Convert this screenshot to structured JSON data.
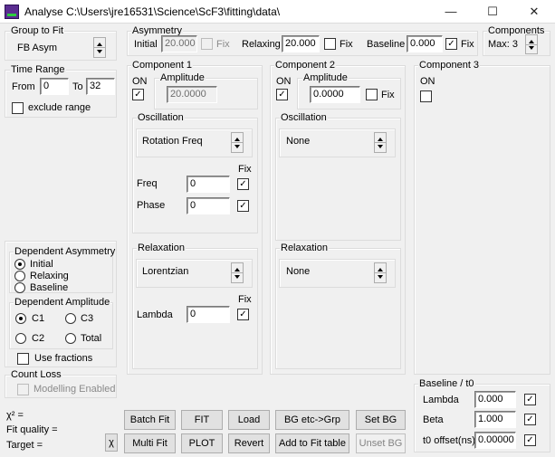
{
  "window": {
    "title": "Analyse C:\\Users\\jre16531\\Science\\ScF3\\fitting\\data\\",
    "min_glyph": "—",
    "max_glyph": "☐",
    "close_glyph": "✕"
  },
  "group_to_fit": {
    "legend": "Group to Fit",
    "value": "FB Asym"
  },
  "time_range": {
    "legend": "Time Range",
    "from_label": "From",
    "from_value": "0",
    "to_label": "To",
    "to_value": "32",
    "exclude_label": "exclude range"
  },
  "asymmetry": {
    "legend": "Asymmetry",
    "initial_label": "Initial",
    "initial_value": "20.000",
    "initial_fix": "Fix",
    "relaxing_label": "Relaxing",
    "relaxing_value": "20.000",
    "relaxing_fix": "Fix",
    "baseline_label": "Baseline",
    "baseline_value": "0.000",
    "baseline_fix": "Fix"
  },
  "components": {
    "legend": "Components",
    "max_label": "Max: 3"
  },
  "component1": {
    "legend": "Component 1",
    "on_label": "ON",
    "amplitude_legend": "Amplitude",
    "amplitude_value": "20.0000",
    "osc_legend": "Oscillation",
    "osc_value": "Rotation Freq",
    "fix_header": "Fix",
    "freq_label": "Freq",
    "freq_value": "0",
    "phase_label": "Phase",
    "phase_value": "0",
    "relax_legend": "Relaxation",
    "relax_value": "Lorentzian",
    "lambda_fix_header": "Fix",
    "lambda_label": "Lambda",
    "lambda_value": "0"
  },
  "component2": {
    "legend": "Component 2",
    "on_label": "ON",
    "amplitude_legend": "Amplitude",
    "amplitude_value": "0.0000",
    "amplitude_fix": "Fix",
    "osc_legend": "Oscillation",
    "osc_value": "None",
    "relax_legend": "Relaxation",
    "relax_value": "None"
  },
  "component3": {
    "legend": "Component 3",
    "on_label": "ON"
  },
  "dependent_asymmetry": {
    "legend": "Dependent Asymmetry",
    "options": [
      "Initial",
      "Relaxing",
      "Baseline"
    ]
  },
  "dependent_amplitude": {
    "legend": "Dependent Amplitude",
    "c1": "C1",
    "c3": "C3",
    "c2": "C2",
    "total": "Total"
  },
  "use_fractions": "Use fractions",
  "count_loss": {
    "legend": "Count Loss",
    "modelling_label": "Modelling Enabled"
  },
  "stats": {
    "chi2_label": "χ² =",
    "fit_quality_label": "Fit quality =",
    "target_label": "Target =",
    "chi_button": "χ"
  },
  "buttons": {
    "batch_fit": "Batch Fit",
    "fit": "FIT",
    "load": "Load",
    "bg_etc": "BG etc->Grp",
    "set_bg": "Set BG",
    "multi_fit": "Multi Fit",
    "plot": "PLOT",
    "revert": "Revert",
    "add_to_fit_table": "Add to Fit table",
    "unset_bg": "Unset BG"
  },
  "baseline_t0": {
    "legend": "Baseline / t0",
    "lambda_label": "Lambda",
    "lambda_value": "0.000",
    "beta_label": "Beta",
    "beta_value": "1.000",
    "t0_label": "t0 offset(ns)",
    "t0_value": "0.00000"
  }
}
